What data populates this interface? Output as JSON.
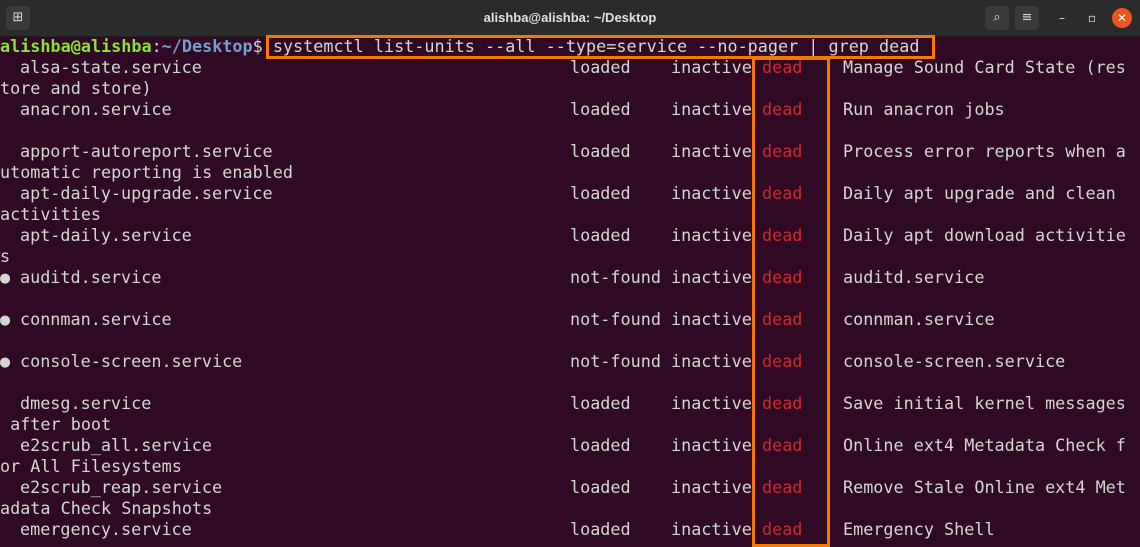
{
  "window": {
    "title": "alishba@alishba: ~/Desktop",
    "icons": [
      "new-tab-icon",
      "search-icon",
      "hamburger-menu-icon",
      "minimize-icon",
      "maximize-icon",
      "close-icon"
    ]
  },
  "prompt": {
    "user_host": "alishba@alishba",
    "sep": ":",
    "path": "~/Desktop",
    "dollar": "$",
    "command": "systemctl list-units --all --type=service --no-pager | grep dead"
  },
  "colors": {
    "background": "#300a24",
    "highlight": "#f57900",
    "dead": "#cc2a2a",
    "user": "#8ae234",
    "path": "#729fcf"
  },
  "rows": [
    {
      "bullet": "",
      "unit": "alsa-state.service",
      "load": "loaded",
      "active": "inactive",
      "sub": "dead",
      "desc": "Manage Sound Card State (res",
      "cont": "tore and store)"
    },
    {
      "bullet": "",
      "unit": "anacron.service",
      "load": "loaded",
      "active": "inactive",
      "sub": "dead",
      "desc": "Run anacron jobs",
      "cont": ""
    },
    {
      "bullet": "",
      "unit": "apport-autoreport.service",
      "load": "loaded",
      "active": "inactive",
      "sub": "dead",
      "desc": "Process error reports when a",
      "cont": "utomatic reporting is enabled"
    },
    {
      "bullet": "",
      "unit": "apt-daily-upgrade.service",
      "load": "loaded",
      "active": "inactive",
      "sub": "dead",
      "desc": "Daily apt upgrade and clean",
      "cont": "activities"
    },
    {
      "bullet": "",
      "unit": "apt-daily.service",
      "load": "loaded",
      "active": "inactive",
      "sub": "dead",
      "desc": "Daily apt download activitie",
      "cont": "s"
    },
    {
      "bullet": "●",
      "unit": "auditd.service",
      "load": "not-found",
      "active": "inactive",
      "sub": "dead",
      "desc": "auditd.service",
      "cont": ""
    },
    {
      "bullet": "●",
      "unit": "connman.service",
      "load": "not-found",
      "active": "inactive",
      "sub": "dead",
      "desc": "connman.service",
      "cont": ""
    },
    {
      "bullet": "●",
      "unit": "console-screen.service",
      "load": "not-found",
      "active": "inactive",
      "sub": "dead",
      "desc": "console-screen.service",
      "cont": ""
    },
    {
      "bullet": "",
      "unit": "dmesg.service",
      "load": "loaded",
      "active": "inactive",
      "sub": "dead",
      "desc": "Save initial kernel messages",
      "cont": " after boot"
    },
    {
      "bullet": "",
      "unit": "e2scrub_all.service",
      "load": "loaded",
      "active": "inactive",
      "sub": "dead",
      "desc": "Online ext4 Metadata Check f",
      "cont": "or All Filesystems"
    },
    {
      "bullet": "",
      "unit": "e2scrub_reap.service",
      "load": "loaded",
      "active": "inactive",
      "sub": "dead",
      "desc": "Remove Stale Online ext4 Met",
      "cont": "adata Check Snapshots"
    },
    {
      "bullet": "",
      "unit": "emergency.service",
      "load": "loaded",
      "active": "inactive",
      "sub": "dead",
      "desc": "Emergency Shell",
      "cont": ""
    }
  ]
}
